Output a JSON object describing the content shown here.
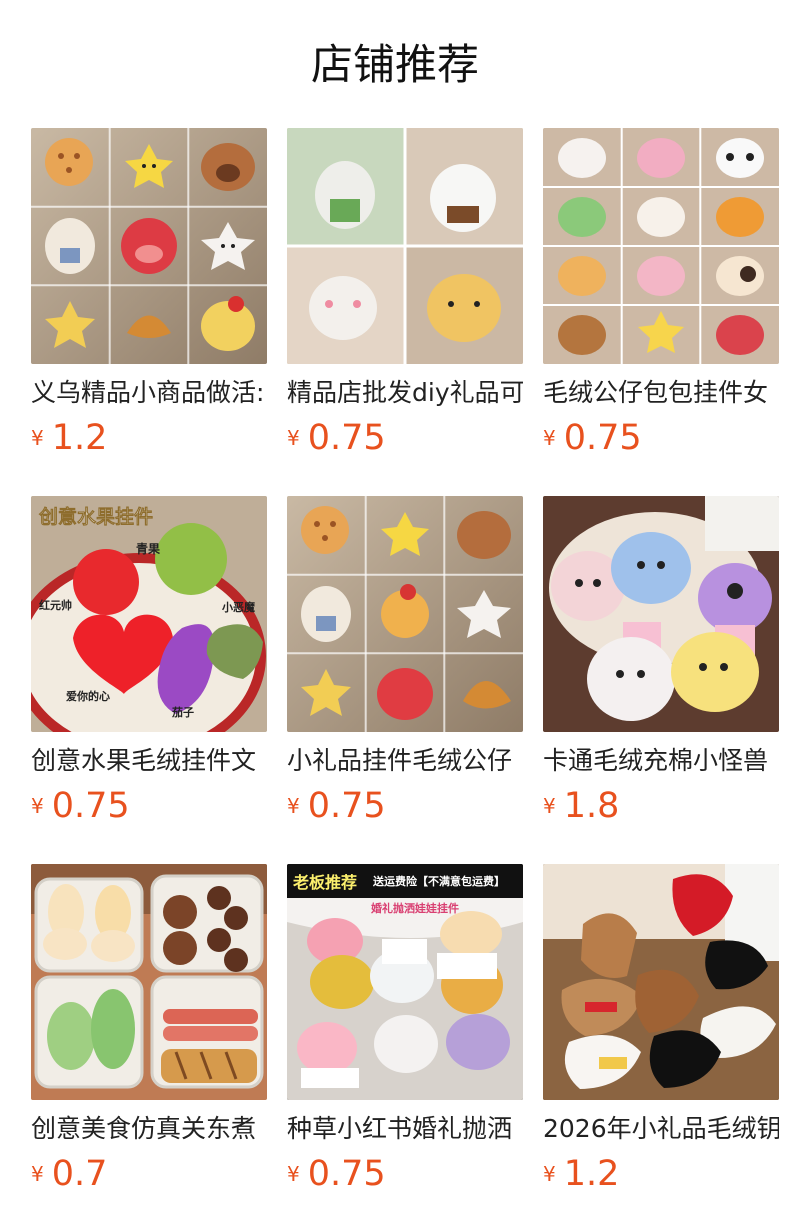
{
  "page": {
    "title": "店铺推荐"
  },
  "products": [
    {
      "name": "义乌精品小商品做活:",
      "currency": "¥",
      "price": "1.2",
      "image": {
        "type": "plush-grid-3x3"
      }
    },
    {
      "name": "精品店批发diy礼品可",
      "currency": "¥",
      "price": "0.75",
      "image": {
        "type": "plush-grid-2x2"
      }
    },
    {
      "name": "毛绒公仔包包挂件女",
      "currency": "¥",
      "price": "0.75",
      "image": {
        "type": "plush-grid-3x3-small"
      }
    },
    {
      "name": "创意水果毛绒挂件文",
      "currency": "¥",
      "price": "0.75",
      "image": {
        "type": "fruit-plush",
        "labels": [
          "创意水果挂件",
          "青果",
          "红元帅",
          "小恶魔",
          "爱你的心",
          "茄子"
        ]
      }
    },
    {
      "name": "小礼品挂件毛绒公仔",
      "currency": "¥",
      "price": "0.75",
      "image": {
        "type": "plush-grid-3x3"
      }
    },
    {
      "name": "卡通毛绒充棉小怪兽",
      "currency": "¥",
      "price": "1.8",
      "image": {
        "type": "monster-plush"
      }
    },
    {
      "name": "创意美食仿真关东煮",
      "currency": "¥",
      "price": "0.7",
      "image": {
        "type": "food-plush"
      }
    },
    {
      "name": "种草小红书婚礼抛洒",
      "currency": "¥",
      "price": "0.75",
      "image": {
        "type": "wedding-plush",
        "labels": [
          "老板推荐",
          "送运费险【不满意包运费】",
          "婚礼抛洒娃娃挂件"
        ]
      }
    },
    {
      "name": "2026年小礼品毛绒钥",
      "currency": "¥",
      "price": "1.2",
      "image": {
        "type": "horse-plush"
      }
    }
  ]
}
